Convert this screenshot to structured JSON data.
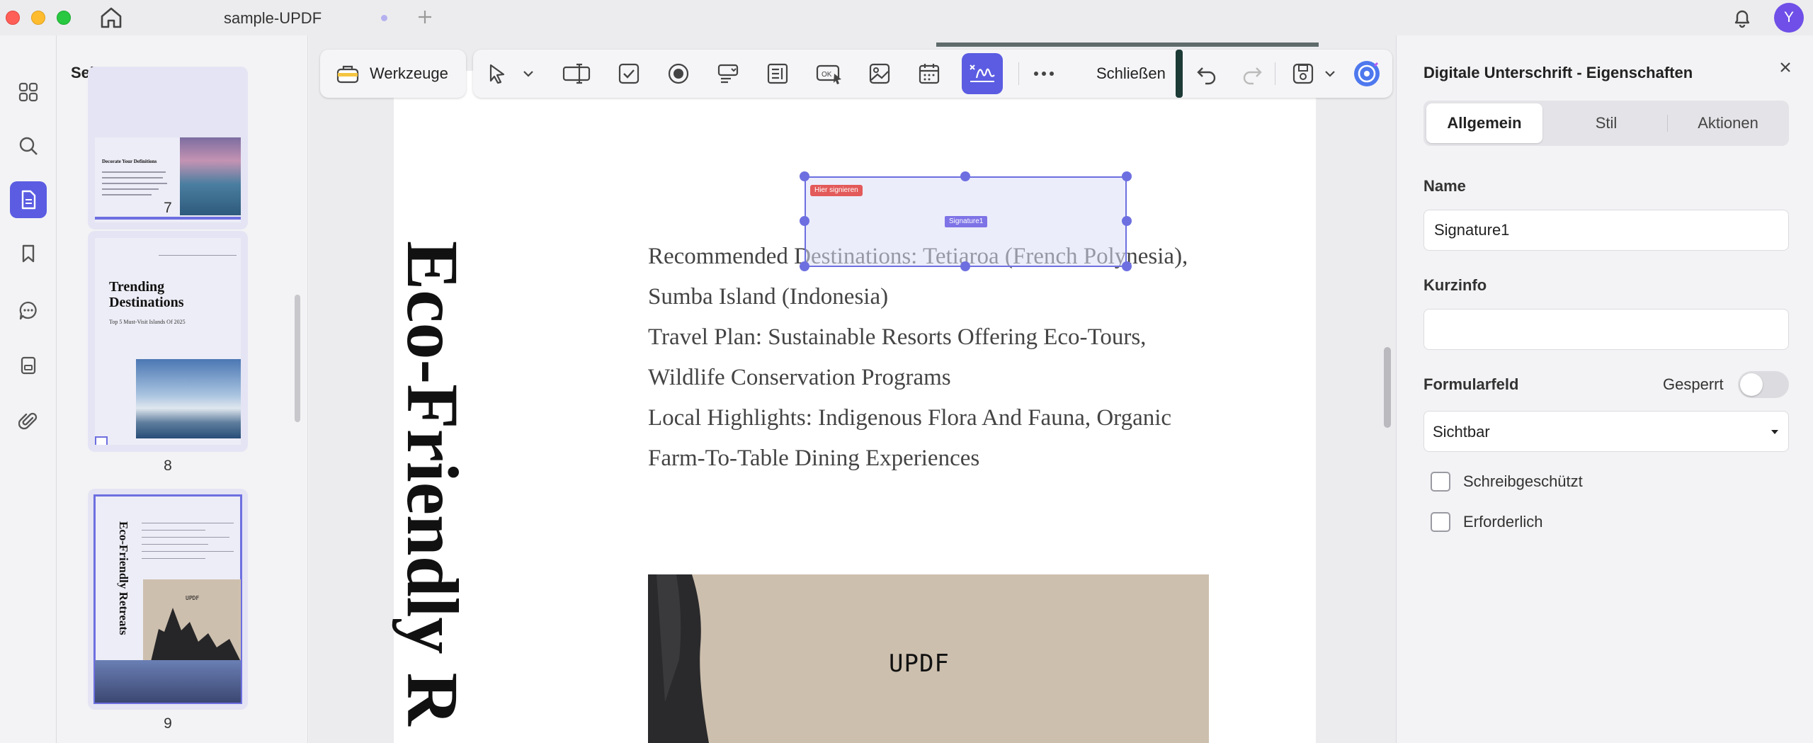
{
  "app": {
    "tab_title": "sample-UPDF",
    "avatar_initial": "Y"
  },
  "rail": {
    "icons": [
      "grid-icon",
      "search-icon",
      "page-icon",
      "bookmark-icon",
      "comment-icon",
      "form-icon",
      "attachment-icon"
    ],
    "active": "page-icon"
  },
  "thumbnails": {
    "title": "Seitenminiaturen",
    "pages": [
      {
        "number": "7",
        "heading": "Decorate Your Definitions"
      },
      {
        "number": "8",
        "heading": "Trending Destinations",
        "subheading": "Top 5 Must-Visit Islands Of 2025"
      },
      {
        "number": "9",
        "heading": "Eco-Friendly Retreats",
        "image_label": "UPDF"
      }
    ]
  },
  "toolbar": {
    "tools_label": "Werkzeuge",
    "close_label": "Schließen",
    "icons": [
      "pointer-icon",
      "text-field-icon",
      "checkbox-icon",
      "radio-button-icon",
      "combo-box-icon",
      "list-box-icon",
      "push-button-icon",
      "image-field-icon",
      "date-field-icon",
      "signature-field-icon",
      "more-icon",
      "undo-icon",
      "redo-icon",
      "save-icon",
      "ai-assistant-icon"
    ]
  },
  "document": {
    "vertical_title": "Eco-Friendly R",
    "lines": [
      "Recommended Destinations: Tetiaroa (French Polynesia),",
      "Sumba Island (Indonesia)",
      "Travel Plan: Sustainable Resorts Offering Eco-Tours,",
      "Wildlife Conservation Programs",
      "Local Highlights: Indigenous Flora And Fauna, Organic",
      "Farm-To-Table Dining Experiences"
    ],
    "image_label": "UPDF",
    "signature_field": {
      "hint": "Hier signieren",
      "name": "Signature1"
    }
  },
  "properties": {
    "title": "Digitale Unterschrift - Eigenschaften",
    "tabs": [
      "Allgemein",
      "Stil",
      "Aktionen"
    ],
    "active_tab": "Allgemein",
    "name_label": "Name",
    "name_value": "Signature1",
    "tooltip_label": "Kurzinfo",
    "tooltip_value": "",
    "form_field_label": "Formularfeld",
    "locked_label": "Gesperrt",
    "locked": false,
    "visibility_value": "Sichtbar",
    "checkboxes": [
      {
        "label": "Schreibgeschützt",
        "checked": false
      },
      {
        "label": "Erforderlich",
        "checked": false
      }
    ]
  },
  "colors": {
    "accent": "#5b5ce2",
    "signature_hint": "#e35a5a"
  }
}
